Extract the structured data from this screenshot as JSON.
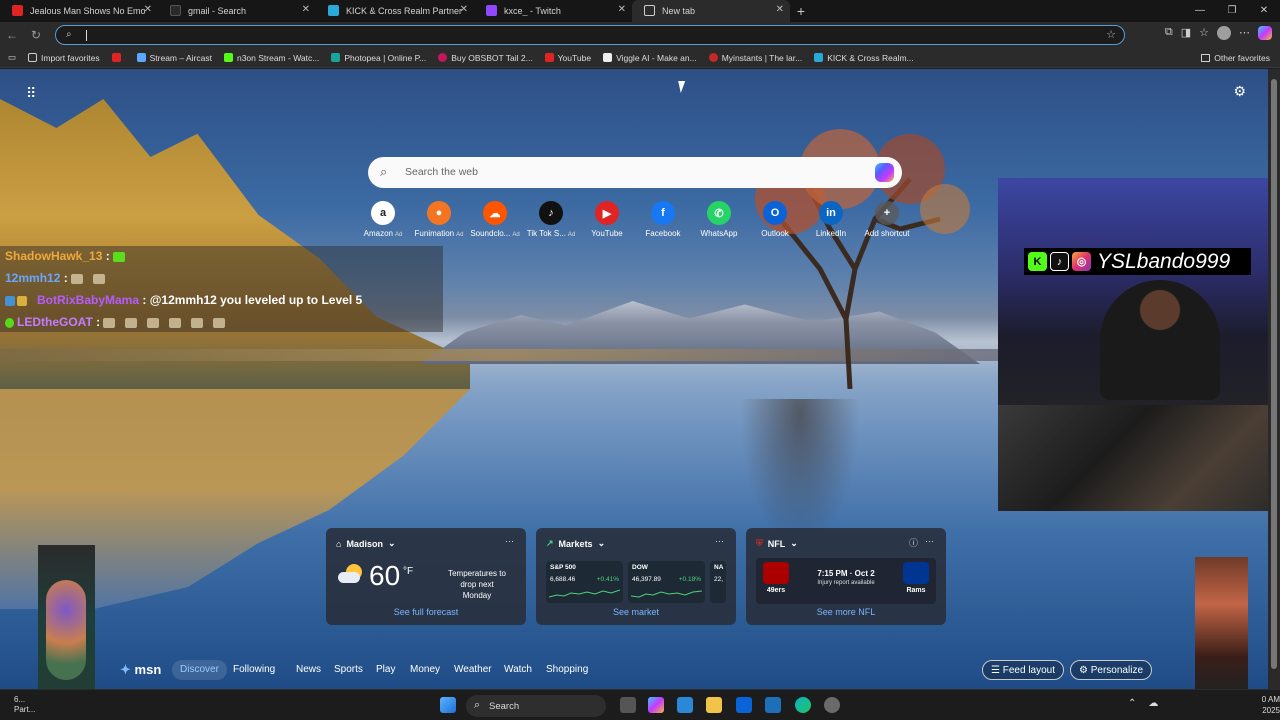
{
  "tabs": [
    {
      "title": "Jealous Man Shows No Emo",
      "favicon_color": "#e02424",
      "active": false
    },
    {
      "title": "gmail - Search",
      "favicon_color": "#2a2a2a",
      "active": false
    },
    {
      "title": "KICK & Cross Realm Partner Fast",
      "favicon_color": "#2aa8d8",
      "active": false
    },
    {
      "title": "kxce_ - Twitch",
      "favicon_color": "#9146ff",
      "active": false
    },
    {
      "title": "New tab",
      "favicon_color": "#cfcfcf",
      "active": true
    }
  ],
  "omnibox": {
    "value": ""
  },
  "bookmarks": [
    {
      "label": "Import favorites",
      "color": "#cfcfcf"
    },
    {
      "label": "",
      "color": "#e02424"
    },
    {
      "label": "Stream – Aircast",
      "color": "#5aa9ff"
    },
    {
      "label": "n3on Stream - Watc...",
      "color": "#53fc18"
    },
    {
      "label": "Photopea | Online P...",
      "color": "#18a497"
    },
    {
      "label": "Buy OBSBOT Tail 2...",
      "color": "#c2185b"
    },
    {
      "label": "YouTube",
      "color": "#e02424"
    },
    {
      "label": "Viggle AI - Make an...",
      "color": "#eeeeee"
    },
    {
      "label": "Myinstants | The lar...",
      "color": "#c62828"
    },
    {
      "label": "KICK & Cross Realm...",
      "color": "#2aa8d8"
    }
  ],
  "other_favorites": "Other favorites",
  "search": {
    "placeholder": "Search the web"
  },
  "shortcuts": [
    {
      "label": "Amazon",
      "ad": "Ad",
      "glyph": "a",
      "color": "#222222"
    },
    {
      "label": "Funimation",
      "ad": "Ad",
      "glyph": "●",
      "color": "#f47521"
    },
    {
      "label": "Soundclo...",
      "ad": "Ad",
      "glyph": "☁",
      "color": "#ff5500"
    },
    {
      "label": "Tik Tok S...",
      "ad": "Ad",
      "glyph": "♪",
      "color": "#111111"
    },
    {
      "label": "YouTube",
      "ad": "",
      "glyph": "▶",
      "color": "#e02424"
    },
    {
      "label": "Facebook",
      "ad": "",
      "glyph": "f",
      "color": "#1877f2"
    },
    {
      "label": "WhatsApp",
      "ad": "",
      "glyph": "✆",
      "color": "#25d366"
    },
    {
      "label": "Outlook",
      "ad": "",
      "glyph": "O",
      "color": "#0a64d8"
    },
    {
      "label": "LinkedIn",
      "ad": "",
      "glyph": "in",
      "color": "#0a66c2"
    },
    {
      "label": "Add shortcut",
      "ad": "",
      "glyph": "+",
      "color": "#555555"
    }
  ],
  "chat": [
    {
      "user": "ShadowHawk_13",
      "color": "#f2a93b",
      "sep": ":",
      "message": ""
    },
    {
      "user": "12mmh12",
      "color": "#6aa7ff",
      "sep": ":",
      "message": ""
    },
    {
      "user": "BotRixBabyMama",
      "color": "#b65cff",
      "sep": ":",
      "message": "@12mmh12 you leveled up to Level 5"
    },
    {
      "user": "LEDtheGOAT",
      "color": "#c27cff",
      "sep": ":",
      "message": ""
    }
  ],
  "stream_overlay": {
    "handle": "YSLbando999"
  },
  "weather": {
    "location": "Madison",
    "temp": "60",
    "unit": "°F",
    "note": "Temperatures to drop next Monday",
    "link": "See full forecast"
  },
  "markets": {
    "title": "Markets",
    "stocks": [
      {
        "name": "S&P 500",
        "value": "6,688.46",
        "change": "+0.41%"
      },
      {
        "name": "DOW",
        "value": "46,397.89",
        "change": "+0.18%"
      },
      {
        "name": "NA",
        "value": "22,",
        "change": ""
      }
    ],
    "link": "See market"
  },
  "nfl": {
    "title": "NFL",
    "home": "49ers",
    "away": "Rams",
    "time": "7:15 PM · Oct 2",
    "sub": "Injury report available",
    "link": "See more NFL"
  },
  "feed": {
    "brand": "msn",
    "tabs": [
      "Discover",
      "Following",
      "News",
      "Sports",
      "Play",
      "Money",
      "Weather",
      "Watch",
      "Shopping"
    ],
    "feed_layout": "Feed layout",
    "personalize": "Personalize"
  },
  "taskbar": {
    "search": "Search",
    "weather_temp": "6...",
    "weather_sub": "Part...",
    "time": "0 AM",
    "date": "2025"
  }
}
